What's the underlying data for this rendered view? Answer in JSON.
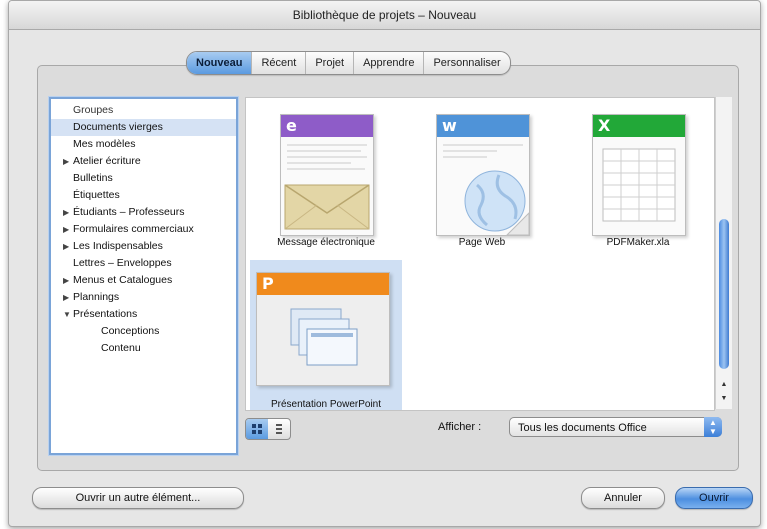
{
  "window": {
    "title": "Bibliothèque de projets – Nouveau"
  },
  "tabs": [
    {
      "label": "Nouveau",
      "active": true
    },
    {
      "label": "Récent",
      "active": false
    },
    {
      "label": "Projet",
      "active": false
    },
    {
      "label": "Apprendre",
      "active": false
    },
    {
      "label": "Personnaliser",
      "active": false
    }
  ],
  "sidebar": {
    "items": [
      {
        "label": "Groupes",
        "expander": "",
        "header": true
      },
      {
        "label": "Documents vierges",
        "expander": "",
        "selected": true
      },
      {
        "label": "Mes modèles",
        "expander": ""
      },
      {
        "label": "Atelier écriture",
        "expander": "▶"
      },
      {
        "label": "Bulletins",
        "expander": ""
      },
      {
        "label": "Étiquettes",
        "expander": ""
      },
      {
        "label": "Étudiants – Professeurs",
        "expander": "▶"
      },
      {
        "label": "Formulaires commerciaux",
        "expander": "▶"
      },
      {
        "label": "Les Indispensables",
        "expander": "▶"
      },
      {
        "label": "Lettres – Enveloppes",
        "expander": ""
      },
      {
        "label": "Menus et Catalogues",
        "expander": "▶"
      },
      {
        "label": "Plannings",
        "expander": "▶"
      },
      {
        "label": "Présentations",
        "expander": "▼"
      },
      {
        "label": "Conceptions",
        "expander": "",
        "child": true
      },
      {
        "label": "Contenu",
        "expander": "",
        "child": true
      }
    ]
  },
  "templates": [
    {
      "label": "Message électronique",
      "badge": "e",
      "color": "#8e5cc8",
      "selected": false
    },
    {
      "label": "Page Web",
      "badge": "w",
      "color": "#4f93d8",
      "selected": false
    },
    {
      "label": "PDFMaker.xla",
      "badge": "X",
      "color": "#22a838",
      "selected": false
    },
    {
      "label": "Présentation PowerPoint",
      "badge": "P",
      "color": "#f08a1c",
      "selected": true
    }
  ],
  "view": {
    "afficher_label": "Afficher :",
    "filter_value": "Tous les documents Office"
  },
  "buttons": {
    "open_other": "Ouvrir un autre élément...",
    "cancel": "Annuler",
    "open": "Ouvrir"
  },
  "colors": {
    "accent": "#5b9be1",
    "selection": "#cfdff3"
  }
}
